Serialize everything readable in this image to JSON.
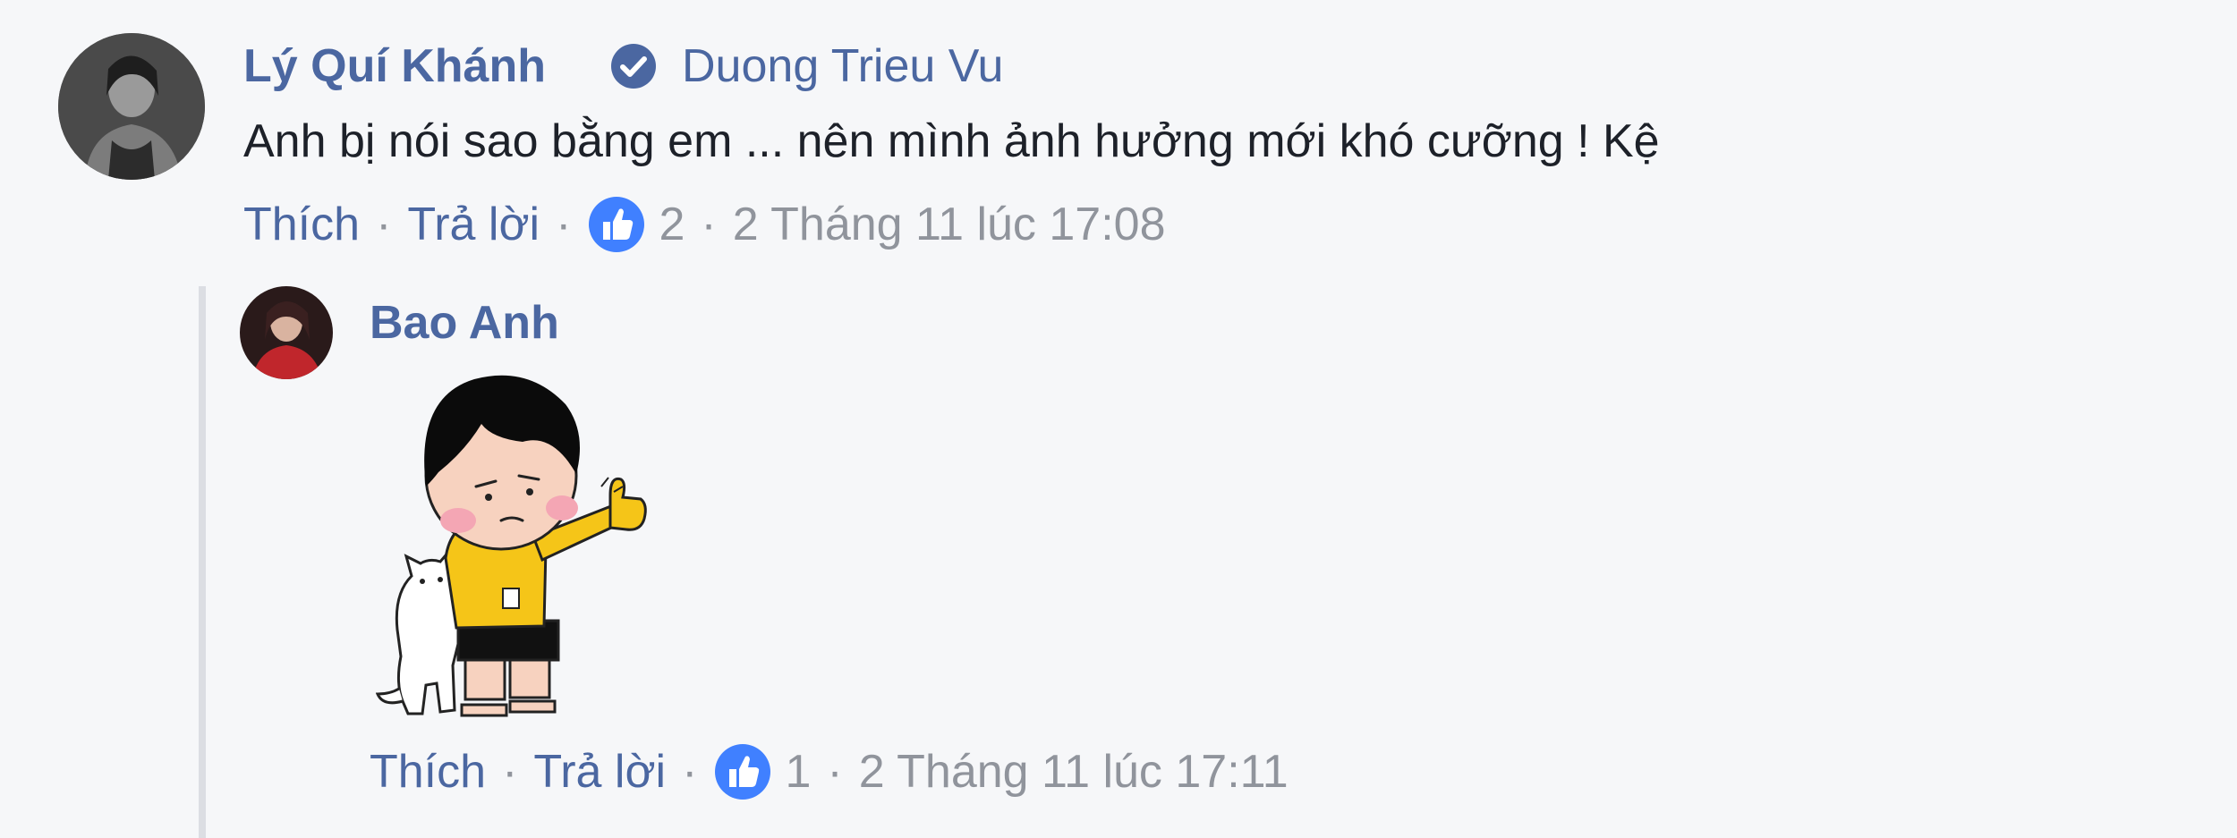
{
  "comment": {
    "author": "Lý Quí Khánh",
    "tagged_user": "Duong Trieu Vu",
    "text": "Anh bị nói sao bằng em ... nên mình ảnh hưởng mới khó cưỡng ! Kệ",
    "actions": {
      "like_label": "Thích",
      "reply_label": "Trả lời",
      "separator": "·",
      "like_count": "2",
      "timestamp": "2 Tháng 11 lúc 17:08"
    }
  },
  "reply": {
    "author": "Bao Anh",
    "attachment_icon": "sticker-girl-thumbs-up-with-cat",
    "actions": {
      "like_label": "Thích",
      "reply_label": "Trả lời",
      "separator": "·",
      "like_count": "1",
      "timestamp": "2 Tháng 11 lúc 17:11"
    }
  },
  "colors": {
    "background": "#f6f7f9",
    "link": "#4b67a1",
    "text": "#1d2129",
    "meta": "#90949c",
    "like_blue": "#4080ff",
    "thread_line": "#dcdee3"
  }
}
